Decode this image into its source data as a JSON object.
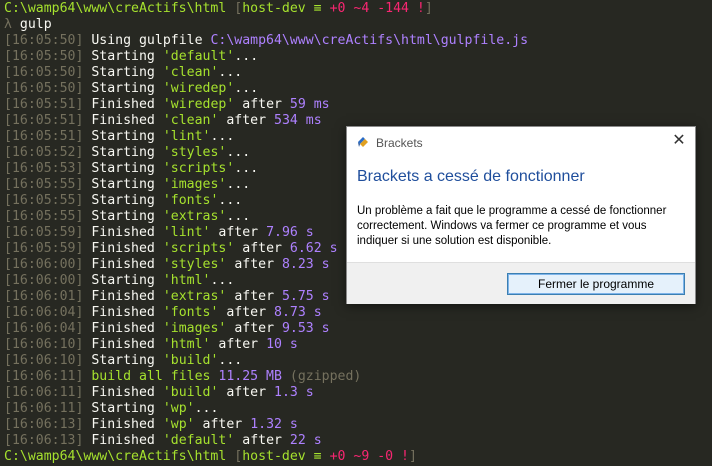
{
  "prompt_top": {
    "path": "C:\\wamp64\\www\\creActifs\\html",
    "branch_open": " [",
    "branch": "host-dev",
    "branch_sym": " ≡ ",
    "stat1": "+0",
    "stat2": " ~4",
    "stat3": " -144",
    "stat_close": " !",
    "branch_close": "]"
  },
  "command_line": {
    "prompt_char": "λ",
    "command": "gulp"
  },
  "log_lines": [
    {
      "ts": "[16:05:50]",
      "verb": "Using gulpfile",
      "task": "",
      "after": "",
      "time": "",
      "extra": "C:\\wamp64\\www\\creActifs\\html\\gulpfile.js"
    },
    {
      "ts": "[16:05:50]",
      "verb": "Starting",
      "task": "'default'",
      "after": "...",
      "time": "",
      "extra": ""
    },
    {
      "ts": "[16:05:50]",
      "verb": "Starting",
      "task": "'clean'",
      "after": "...",
      "time": "",
      "extra": ""
    },
    {
      "ts": "[16:05:50]",
      "verb": "Starting",
      "task": "'wiredep'",
      "after": "...",
      "time": "",
      "extra": ""
    },
    {
      "ts": "[16:05:51]",
      "verb": "Finished",
      "task": "'wiredep'",
      "after": " after ",
      "time": "59 ms",
      "extra": ""
    },
    {
      "ts": "[16:05:51]",
      "verb": "Finished",
      "task": "'clean'",
      "after": " after ",
      "time": "534 ms",
      "extra": ""
    },
    {
      "ts": "[16:05:51]",
      "verb": "Starting",
      "task": "'lint'",
      "after": "...",
      "time": "",
      "extra": ""
    },
    {
      "ts": "[16:05:52]",
      "verb": "Starting",
      "task": "'styles'",
      "after": "...",
      "time": "",
      "extra": ""
    },
    {
      "ts": "[16:05:53]",
      "verb": "Starting",
      "task": "'scripts'",
      "after": "...",
      "time": "",
      "extra": ""
    },
    {
      "ts": "[16:05:55]",
      "verb": "Starting",
      "task": "'images'",
      "after": "...",
      "time": "",
      "extra": ""
    },
    {
      "ts": "[16:05:55]",
      "verb": "Starting",
      "task": "'fonts'",
      "after": "...",
      "time": "",
      "extra": ""
    },
    {
      "ts": "[16:05:55]",
      "verb": "Starting",
      "task": "'extras'",
      "after": "...",
      "time": "",
      "extra": ""
    },
    {
      "ts": "[16:05:59]",
      "verb": "Finished",
      "task": "'lint'",
      "after": " after ",
      "time": "7.96 s",
      "extra": ""
    },
    {
      "ts": "[16:05:59]",
      "verb": "Finished",
      "task": "'scripts'",
      "after": " after ",
      "time": "6.62 s",
      "extra": ""
    },
    {
      "ts": "[16:06:00]",
      "verb": "Finished",
      "task": "'styles'",
      "after": " after ",
      "time": "8.23 s",
      "extra": ""
    },
    {
      "ts": "[16:06:00]",
      "verb": "Starting",
      "task": "'html'",
      "after": "...",
      "time": "",
      "extra": ""
    },
    {
      "ts": "[16:06:01]",
      "verb": "Finished",
      "task": "'extras'",
      "after": " after ",
      "time": "5.75 s",
      "extra": ""
    },
    {
      "ts": "[16:06:04]",
      "verb": "Finished",
      "task": "'fonts'",
      "after": " after ",
      "time": "8.73 s",
      "extra": ""
    },
    {
      "ts": "[16:06:04]",
      "verb": "Finished",
      "task": "'images'",
      "after": " after ",
      "time": "9.53 s",
      "extra": ""
    },
    {
      "ts": "[16:06:10]",
      "verb": "Finished",
      "task": "'html'",
      "after": " after ",
      "time": "10 s",
      "extra": ""
    },
    {
      "ts": "[16:06:10]",
      "verb": "Starting",
      "task": "'build'",
      "after": "...",
      "time": "",
      "extra": ""
    },
    {
      "ts": "[16:06:11]",
      "verb": "",
      "task": "",
      "after": "",
      "time": "",
      "extra": "",
      "build_text": "build all files",
      "build_size": "11.25 MB",
      "build_gz": " (gzipped)"
    },
    {
      "ts": "[16:06:11]",
      "verb": "Finished",
      "task": "'build'",
      "after": " after ",
      "time": "1.3 s",
      "extra": ""
    },
    {
      "ts": "[16:06:11]",
      "verb": "Starting",
      "task": "'wp'",
      "after": "...",
      "time": "",
      "extra": ""
    },
    {
      "ts": "[16:06:13]",
      "verb": "Finished",
      "task": "'wp'",
      "after": " after ",
      "time": "1.32 s",
      "extra": ""
    },
    {
      "ts": "[16:06:13]",
      "verb": "Finished",
      "task": "'default'",
      "after": " after ",
      "time": "22 s",
      "extra": ""
    }
  ],
  "prompt_bottom": {
    "path": "C:\\wamp64\\www\\creActifs\\html",
    "branch_open": " [",
    "branch": "host-dev",
    "branch_sym": " ≡ ",
    "stat1": "+0",
    "stat2": " ~9",
    "stat3": " -0",
    "stat_close": " !",
    "branch_close": "]"
  },
  "dialog": {
    "title": "Brackets",
    "heading": "Brackets a cessé de fonctionner",
    "message": "Un problème a fait que le programme a cessé de fonctionner correctement. Windows va fermer ce programme et vous indiquer si une solution est disponible.",
    "button_label": "Fermer le programme",
    "close_glyph": "✕"
  },
  "colors": {
    "background": "#272822",
    "string": "#a6e22e",
    "number": "#ae81ff",
    "timestamp": "#75715e",
    "dialog_heading": "#1f4e9c"
  }
}
